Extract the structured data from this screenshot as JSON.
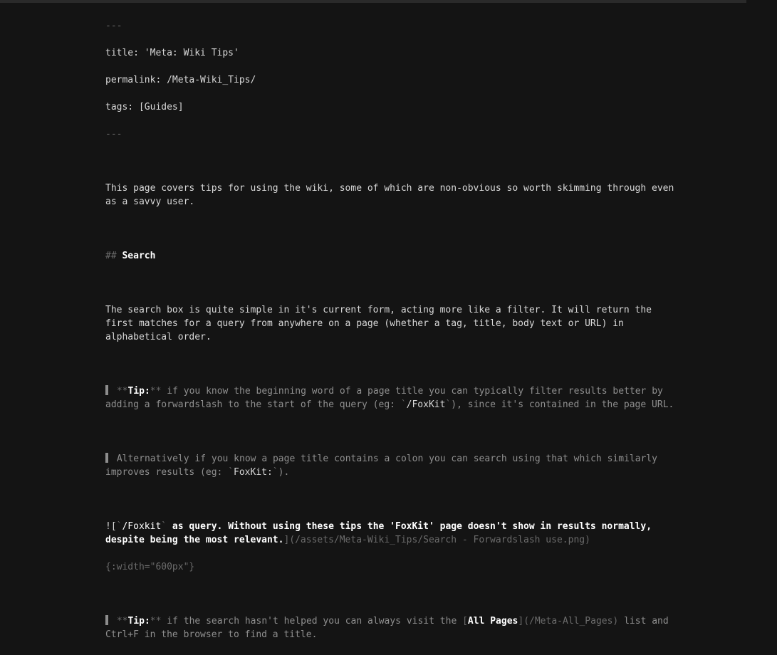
{
  "frontmatter": {
    "open": "---",
    "title_line": "title: 'Meta: Wiki Tips'",
    "permalink_line": "permalink: /Meta-Wiki_Tips/",
    "tags_line": "tags: [Guides]",
    "close": "---"
  },
  "intro": "This page covers tips for using the wiki, some of which are non-obvious so worth skimming through even as a savvy user.",
  "heading": {
    "prefix": "## ",
    "text": "Search"
  },
  "para_search": "The search box is quite simple in it's current form, acting more like a filter. It will return the first matches for a query from anywhere on a page (whether a tag, title, body text or URL) in alphabetical order.",
  "tip1": {
    "prefix": " **",
    "tip_word": "Tip:",
    "after_tip": "**",
    "body1": " if you know the beginning word of a page title you can typically filter results better by adding a forwardslash to the start of the query (eg: ",
    "code_tick1": "`",
    "code_val": "/FoxKit",
    "code_tick2": "`",
    "body2": "), since it's contained in the page URL."
  },
  "tip1b": {
    "body1": " Alternatively if you know a page title contains a colon you can search using that which similarly improves results (eg: ",
    "code_tick1": "`",
    "code_val": "FoxKit:",
    "code_tick2": "`",
    "body2": ")."
  },
  "img": {
    "bang": "![",
    "alt_tick1": "`",
    "alt_code": "/Foxkit",
    "alt_tick2": "`",
    "alt_rest": " as query. Without using these tips the 'FoxKit' page doesn't show in results normally, despite being the most relevant.",
    "url": "](/assets/Meta-Wiki_Tips/Search - Forwardslash use.png)",
    "attr": "{:width=\"600px\"}"
  },
  "tip2": {
    "prefix": " **",
    "tip_word": "Tip:",
    "after_tip": "**",
    "body1": " if the search hasn't helped you can always visit the ",
    "link_open": "[",
    "link_text": "All Pages",
    "link_close": "]",
    "link_url": "(/Meta-All_Pages)",
    "body2": " list and Ctrl+F in the browser to find a title."
  }
}
